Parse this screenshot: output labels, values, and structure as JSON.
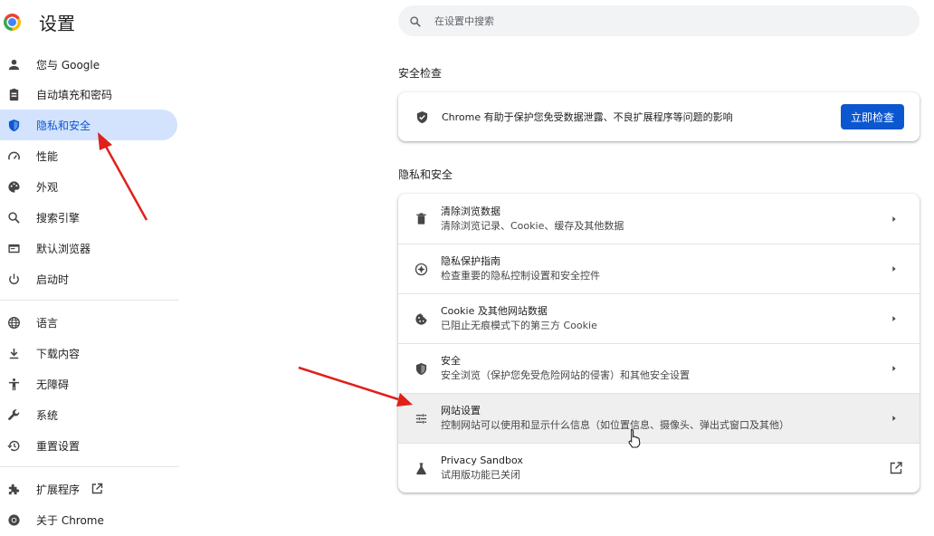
{
  "app": {
    "title": "设置"
  },
  "sidebar": {
    "items": [
      {
        "label": "您与 Google"
      },
      {
        "label": "自动填充和密码"
      },
      {
        "label": "隐私和安全"
      },
      {
        "label": "性能"
      },
      {
        "label": "外观"
      },
      {
        "label": "搜索引擎"
      },
      {
        "label": "默认浏览器"
      },
      {
        "label": "启动时"
      },
      {
        "label": "语言"
      },
      {
        "label": "下载内容"
      },
      {
        "label": "无障碍"
      },
      {
        "label": "系统"
      },
      {
        "label": "重置设置"
      },
      {
        "label": "扩展程序"
      },
      {
        "label": "关于 Chrome"
      }
    ]
  },
  "search": {
    "placeholder": "在设置中搜索"
  },
  "safety_check": {
    "heading": "安全检查",
    "text": "Chrome 有助于保护您免受数据泄露、不良扩展程序等问题的影响",
    "button": "立即检查"
  },
  "privacy": {
    "heading": "隐私和安全",
    "rows": [
      {
        "title": "清除浏览数据",
        "subtitle": "清除浏览记录、Cookie、缓存及其他数据",
        "icon": "trash-icon"
      },
      {
        "title": "隐私保护指南",
        "subtitle": "检查重要的隐私控制设置和安全控件",
        "icon": "compass-icon"
      },
      {
        "title": "Cookie 及其他网站数据",
        "subtitle": "已阻止无痕模式下的第三方 Cookie",
        "icon": "cookie-icon"
      },
      {
        "title": "安全",
        "subtitle": "安全浏览（保护您免受危险网站的侵害）和其他安全设置",
        "icon": "shield-icon"
      },
      {
        "title": "网站设置",
        "subtitle": "控制网站可以使用和显示什么信息（如位置信息、摄像头、弹出式窗口及其他）",
        "icon": "tune-icon"
      },
      {
        "title": "Privacy Sandbox",
        "subtitle": "试用版功能已关闭",
        "icon": "flask-icon"
      }
    ]
  },
  "colors": {
    "accent": "#0b57d0",
    "active_bg": "#d3e3fd",
    "annotation_arrow": "#e0201b"
  }
}
